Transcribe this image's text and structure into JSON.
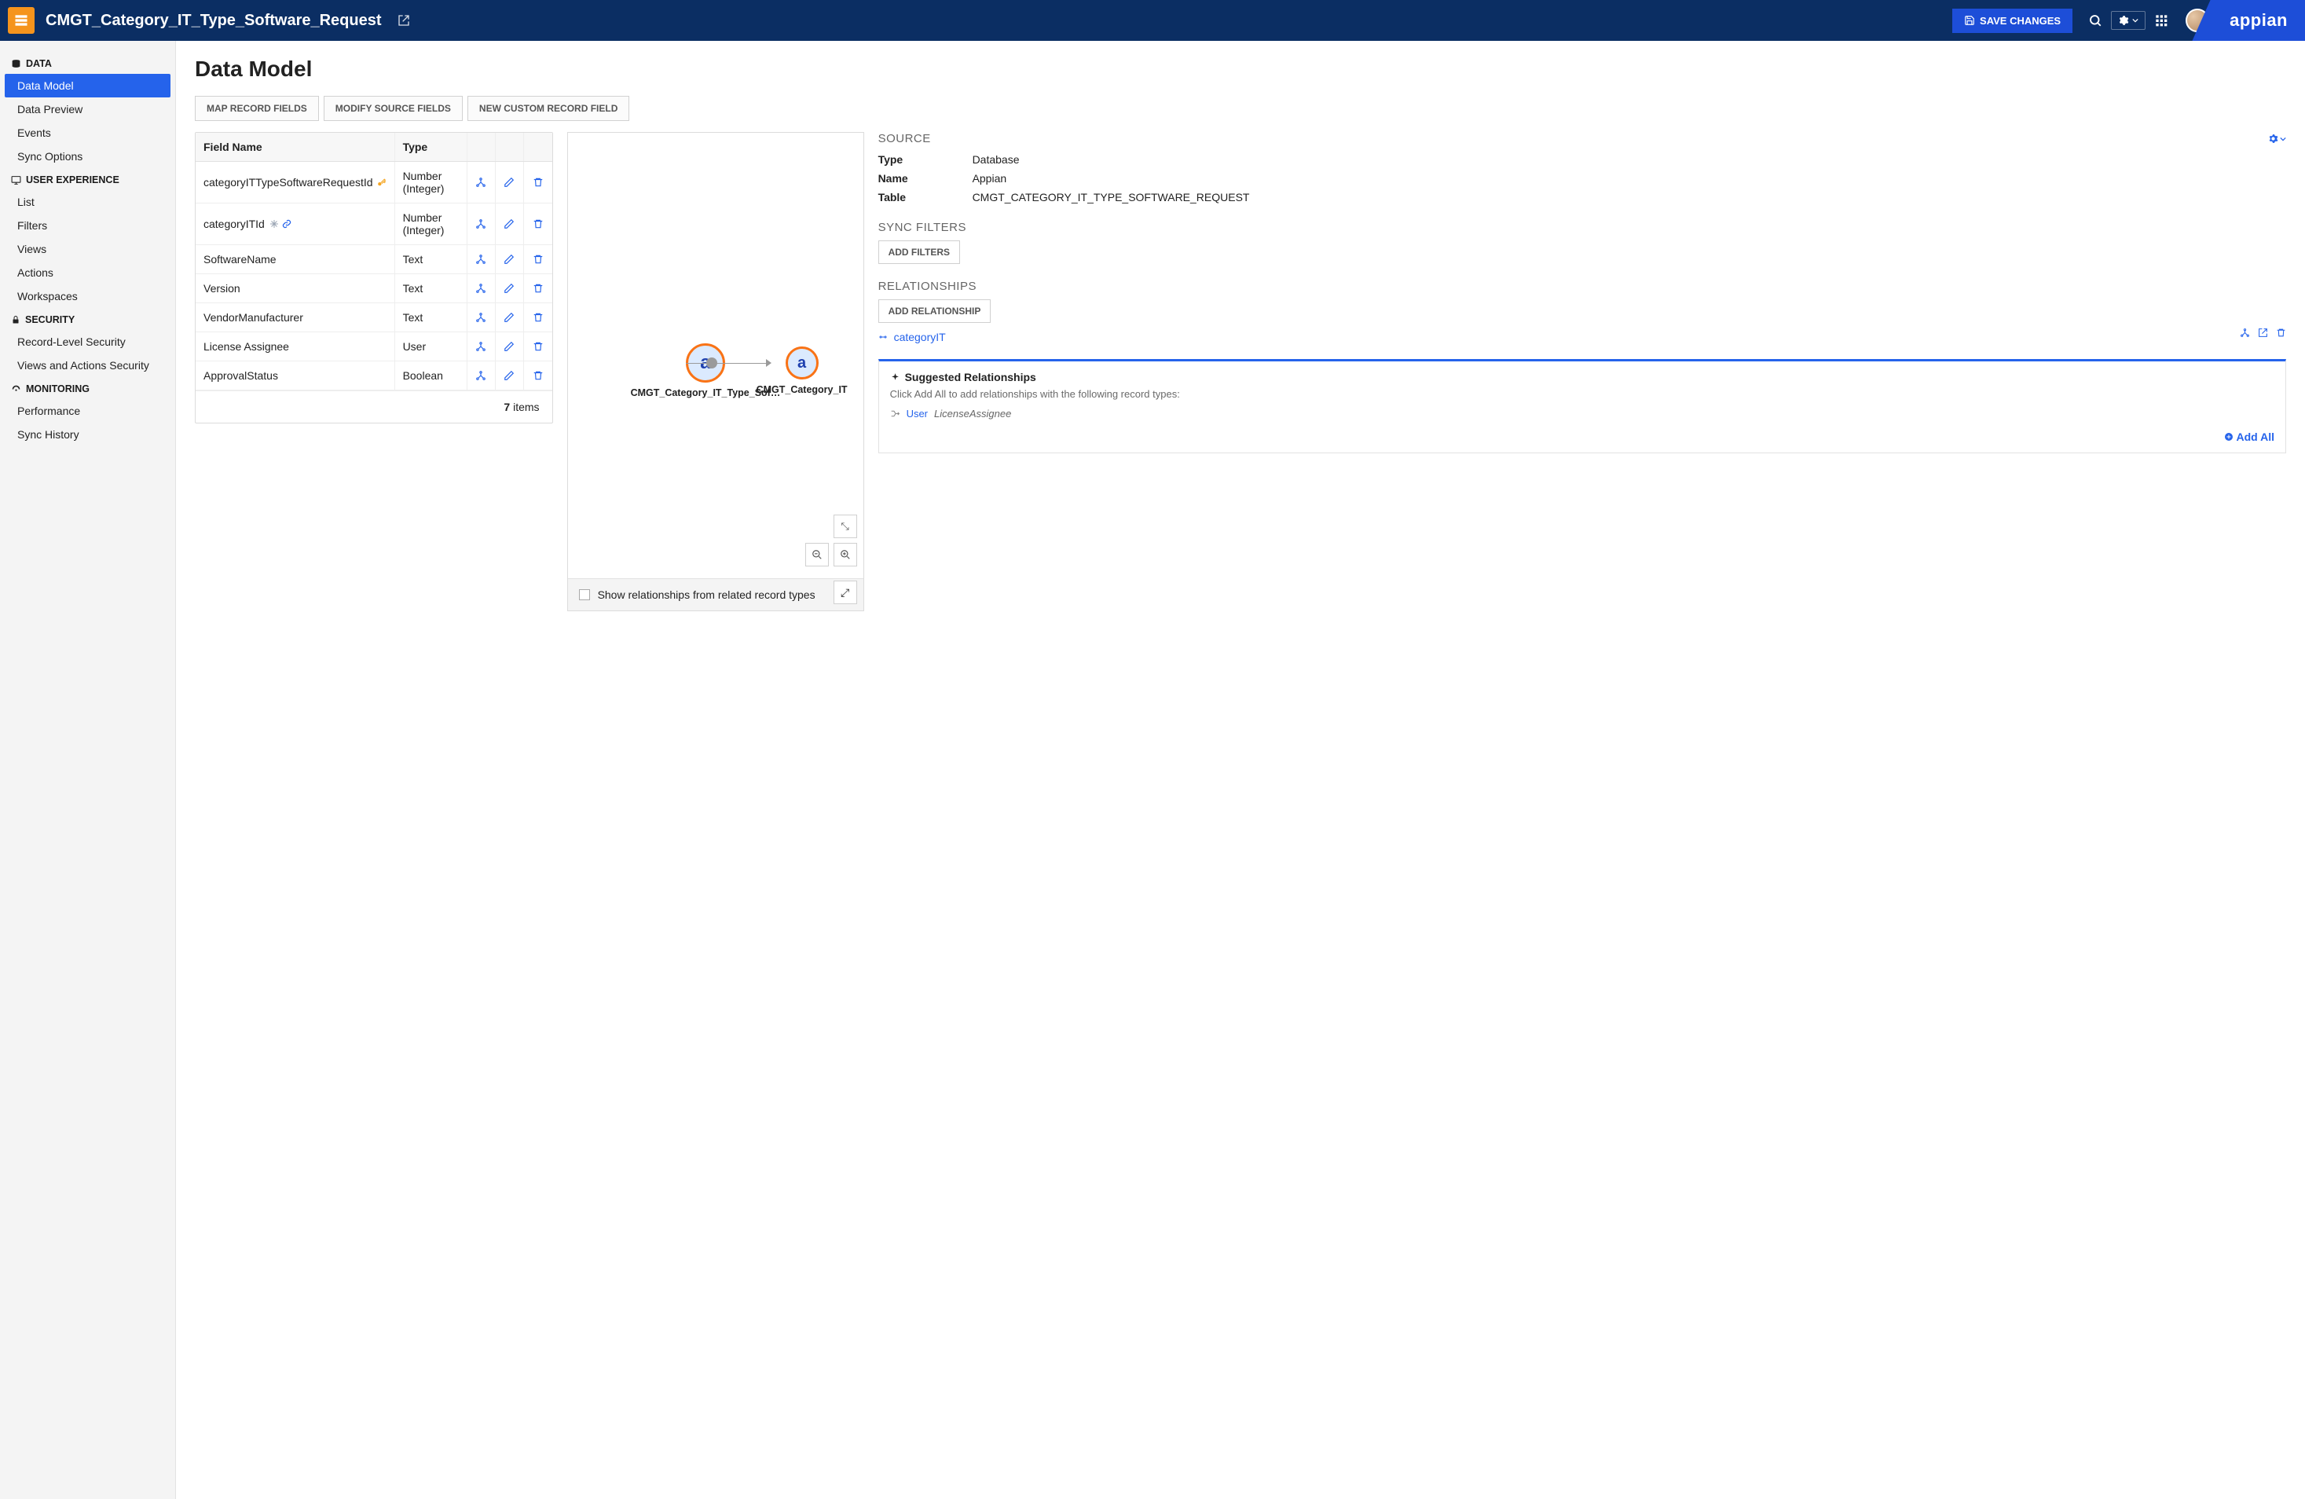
{
  "topbar": {
    "title": "CMGT_Category_IT_Type_Software_Request",
    "save": "SAVE CHANGES",
    "brand": "appian"
  },
  "sidebar": {
    "groups": [
      {
        "label": "DATA",
        "icon": "database",
        "items": [
          {
            "key": "data-model",
            "label": "Data Model",
            "active": true
          },
          {
            "key": "data-preview",
            "label": "Data Preview"
          },
          {
            "key": "events",
            "label": "Events"
          },
          {
            "key": "sync-options",
            "label": "Sync Options"
          }
        ]
      },
      {
        "label": "USER EXPERIENCE",
        "icon": "monitor",
        "items": [
          {
            "key": "list",
            "label": "List"
          },
          {
            "key": "filters",
            "label": "Filters"
          },
          {
            "key": "views",
            "label": "Views"
          },
          {
            "key": "actions",
            "label": "Actions"
          },
          {
            "key": "workspaces",
            "label": "Workspaces"
          }
        ]
      },
      {
        "label": "SECURITY",
        "icon": "lock",
        "items": [
          {
            "key": "rls",
            "label": "Record-Level Security"
          },
          {
            "key": "vas",
            "label": "Views and Actions Security"
          }
        ]
      },
      {
        "label": "MONITORING",
        "icon": "gauge",
        "items": [
          {
            "key": "performance",
            "label": "Performance"
          },
          {
            "key": "sync-history",
            "label": "Sync History"
          }
        ]
      }
    ]
  },
  "main": {
    "title": "Data Model",
    "tabs": [
      "MAP RECORD FIELDS",
      "MODIFY SOURCE FIELDS",
      "NEW CUSTOM RECORD FIELD"
    ],
    "table": {
      "headers": [
        "Field Name",
        "Type"
      ],
      "rows": [
        {
          "name": "categoryITTypeSoftwareRequestId",
          "type": "Number (Integer)",
          "pk": true
        },
        {
          "name": "categoryITId",
          "type": "Number (Integer)",
          "rel": true,
          "snow": true
        },
        {
          "name": "SoftwareName",
          "type": "Text"
        },
        {
          "name": "Version",
          "type": "Text"
        },
        {
          "name": "VendorManufacturer",
          "type": "Text"
        },
        {
          "name": "License Assignee",
          "type": "User"
        },
        {
          "name": "ApprovalStatus",
          "type": "Boolean"
        }
      ],
      "count": "7",
      "count_label": "items"
    },
    "diagram": {
      "node1": "CMGT_Category_IT_Type_Sof…",
      "node2": "CMGT_Category_IT",
      "checkbox_label": "Show relationships from related record types"
    }
  },
  "right": {
    "source": {
      "title": "SOURCE",
      "type_k": "Type",
      "type_v": "Database",
      "name_k": "Name",
      "name_v": "Appian",
      "table_k": "Table",
      "table_v": "CMGT_CATEGORY_IT_TYPE_SOFTWARE_REQUEST"
    },
    "sync_filters": {
      "title": "SYNC FILTERS",
      "btn": "ADD FILTERS"
    },
    "relationships": {
      "title": "RELATIONSHIPS",
      "btn": "ADD RELATIONSHIP",
      "item": "categoryIT"
    },
    "suggested": {
      "title": "Suggested Relationships",
      "text": "Click Add All to add relationships with the following record types:",
      "item_type": "User",
      "item_field": "LicenseAssignee",
      "add_all": "Add All"
    }
  }
}
